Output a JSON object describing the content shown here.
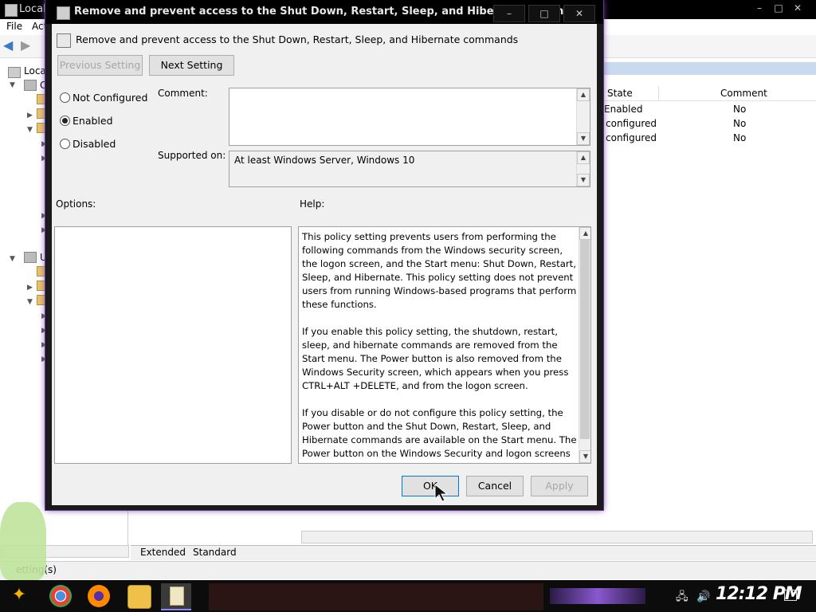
{
  "background_window": {
    "title": "Local",
    "menu": [
      "File",
      "Act"
    ],
    "tree": [
      {
        "label": "Local"
      },
      {
        "label": "C"
      },
      {
        "label": "U"
      }
    ],
    "list": {
      "headers": [
        "State",
        "Comment"
      ],
      "rows": [
        {
          "state": "Enabled",
          "comment": "No"
        },
        {
          "state": "configured",
          "comment": "No"
        },
        {
          "state": "configured",
          "comment": "No"
        }
      ]
    },
    "tabs": [
      "Extended",
      "Standard"
    ],
    "status": "etting(s)"
  },
  "dialog": {
    "title": "Remove and prevent access to the Shut Down, Restart, Sleep, and Hibernate commands",
    "header": "Remove and prevent access to the Shut Down, Restart, Sleep, and Hibernate commands",
    "prev_button": "Previous Setting",
    "next_button": "Next Setting",
    "radios": [
      {
        "label": "Not Configured",
        "checked": false
      },
      {
        "label": "Enabled",
        "checked": true
      },
      {
        "label": "Disabled",
        "checked": false
      }
    ],
    "comment_label": "Comment:",
    "comment_value": "",
    "supported_label": "Supported on:",
    "supported_value": "At least Windows Server, Windows 10",
    "options_label": "Options:",
    "help_label": "Help:",
    "help_text": "This policy setting prevents users from performing the following commands from the Windows security screen, the logon screen, and the Start menu: Shut Down, Restart, Sleep, and Hibernate. This policy setting does not prevent users from running Windows-based programs that perform these functions.\n\nIf you enable this policy setting, the shutdown, restart, sleep, and hibernate commands are removed from the Start menu. The Power button is also removed from the Windows Security screen, which appears when you press CTRL+ALT +DELETE, and from the logon screen.\n\nIf you disable or do not configure this policy setting, the Power button and the Shut Down, Restart, Sleep, and Hibernate commands are available on the Start menu. The Power button on the Windows Security and logon screens is",
    "ok_button": "OK",
    "cancel_button": "Cancel",
    "apply_button": "Apply"
  },
  "taskbar": {
    "clock": "12:12 PM"
  }
}
